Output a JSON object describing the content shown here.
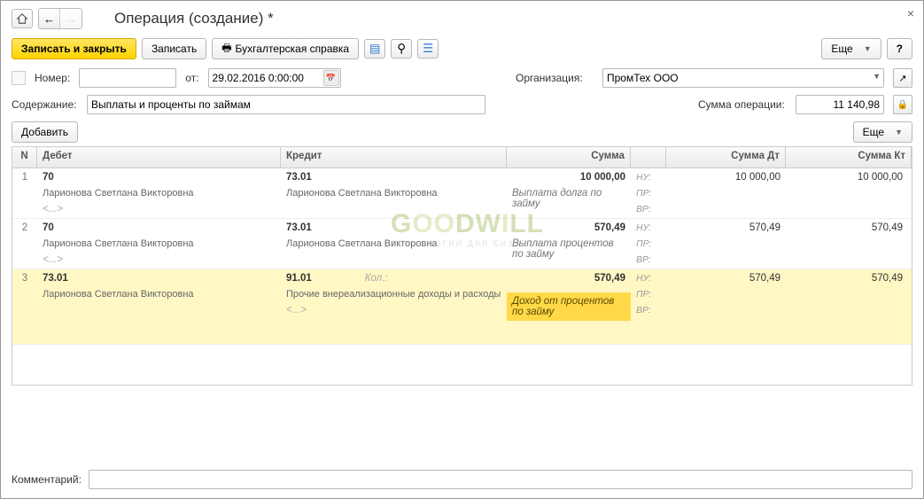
{
  "window": {
    "title": "Операция (создание) *"
  },
  "toolbar": {
    "save_close": "Записать и закрыть",
    "save": "Записать",
    "accounting_ref": "Бухгалтерская справка",
    "more": "Еще",
    "help": "?"
  },
  "form": {
    "number_label": "Номер:",
    "number_value": "",
    "from_label": "от:",
    "date_value": "29.02.2016 0:00:00",
    "org_label": "Организация:",
    "org_value": "ПромТех ООО",
    "content_label": "Содержание:",
    "content_value": "Выплаты и проценты по займам",
    "sum_label": "Сумма операции:",
    "sum_value": "11 140,98",
    "comment_label": "Комментарий:",
    "comment_value": ""
  },
  "sub_toolbar": {
    "add": "Добавить",
    "more": "Еще"
  },
  "grid": {
    "headers": {
      "n": "N",
      "debit": "Дебет",
      "credit": "Кредит",
      "sum": "Сумма",
      "sum_dt": "Сумма Дт",
      "sum_kt": "Сумма Кт"
    },
    "tags": {
      "nu": "НУ:",
      "pr": "ПР:",
      "vr": "ВР:"
    },
    "rows": [
      {
        "n": "1",
        "debit_acct": "70",
        "debit_sub": "Ларионова Светлана Викторовна",
        "debit_ext": "<...>",
        "credit_acct": "73.01",
        "credit_sub": "Ларионова Светлана Викторовна",
        "credit_ext": "",
        "sum": "10 000,00",
        "sum_note": "Выплата долга по займу",
        "sum_dt": "10 000,00",
        "sum_kt": "10 000,00"
      },
      {
        "n": "2",
        "debit_acct": "70",
        "debit_sub": "Ларионова Светлана Викторовна",
        "debit_ext": "<...>",
        "credit_acct": "73.01",
        "credit_sub": "Ларионова Светлана Викторовна",
        "credit_ext": "",
        "sum": "570,49",
        "sum_note": "Выплата процентов по займу",
        "sum_dt": "570,49",
        "sum_kt": "570,49"
      },
      {
        "n": "3",
        "debit_acct": "73.01",
        "debit_sub": "Ларионова Светлана Викторовна",
        "debit_ext": "",
        "credit_acct": "91.01",
        "credit_kol": "Кол.:",
        "credit_sub": "Прочие внереализационные доходы и расходы",
        "credit_ext": "<...>",
        "sum": "570,49",
        "sum_note": "Доход от процентов по займу",
        "sum_dt": "570,49",
        "sum_kt": "570,49"
      }
    ]
  },
  "watermark": {
    "text": "GOODWILL",
    "sub": "ТЕХНОЛОГИИ ДЛЯ БИЗНЕСА"
  }
}
